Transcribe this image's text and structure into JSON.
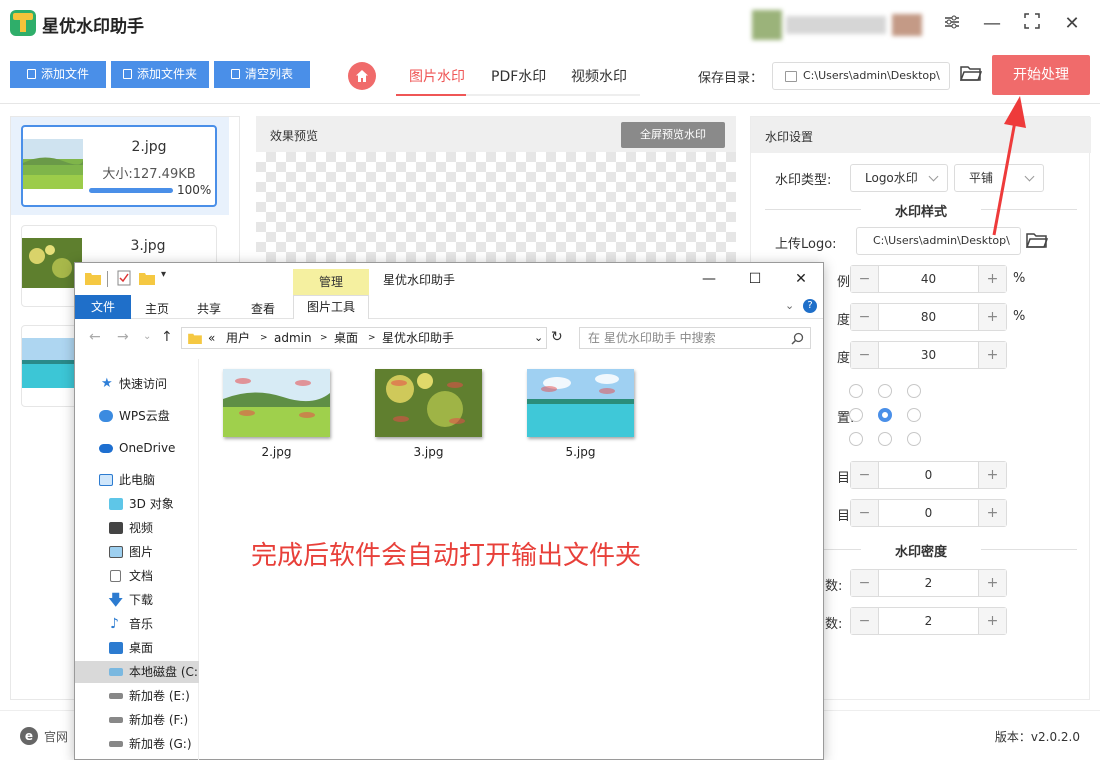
{
  "app": {
    "title": "星优水印助手",
    "window_controls": [
      "settings-icon",
      "minimize-icon",
      "maximize-icon",
      "close-icon"
    ]
  },
  "toolbar": {
    "add_file": "添加文件",
    "add_folder": "添加文件夹",
    "clear_list": "清空列表",
    "tabs": [
      {
        "label": "图片水印",
        "active": true
      },
      {
        "label": "PDF水印",
        "active": false
      },
      {
        "label": "视频水印",
        "active": false
      }
    ],
    "save_dir_label": "保存目录：",
    "save_dir_value": "C:\\Users\\admin\\Desktop\\",
    "start": "开始处理"
  },
  "file_list": [
    {
      "name": "2.jpg",
      "size": "大小:127.49KB",
      "progress": "100%",
      "progress_value": 100,
      "selected": true
    },
    {
      "name": "3.jpg",
      "selected": false
    },
    {
      "name": "5.jpg",
      "selected": false
    }
  ],
  "preview": {
    "title": "效果预览",
    "fullscreen": "全屏预览水印"
  },
  "settings": {
    "title": "水印设置",
    "type_label": "水印类型:",
    "type_value": "Logo水印",
    "mode_value": "平铺",
    "style_section": "水印样式",
    "upload_label": "上传Logo:",
    "upload_value": "C:\\Users\\admin\\Desktop\\",
    "steppers": [
      {
        "label": "例",
        "value": "40",
        "unit": "%"
      },
      {
        "label": "度",
        "value": "80",
        "unit": "%"
      },
      {
        "label": "度",
        "value": "30",
        "unit": ""
      },
      {
        "label": "目",
        "value": "0",
        "unit": ""
      },
      {
        "label": "目",
        "value": "0",
        "unit": ""
      }
    ],
    "position_label": "置:",
    "position_selected": 4,
    "density_section": "水印密度",
    "density": [
      {
        "label": "数:",
        "value": "2"
      },
      {
        "label": "数:",
        "value": "2"
      }
    ]
  },
  "footer": {
    "site": "官网",
    "version": "版本：v2.0.2.0"
  },
  "explorer": {
    "manage": "管理",
    "title": "星优水印助手",
    "ribbon_tabs": [
      "文件",
      "主页",
      "共享",
      "查看"
    ],
    "tools_tab": "图片工具",
    "address": [
      "«",
      "用户",
      "admin",
      "桌面",
      "星优水印助手"
    ],
    "search_placeholder": "在 星优水印助手 中搜索",
    "nav": [
      {
        "label": "快速访问",
        "icon": "star-icon"
      },
      {
        "label": "WPS云盘",
        "icon": "cloud-icon"
      },
      {
        "label": "OneDrive",
        "icon": "onedrive-icon"
      },
      {
        "label": "此电脑",
        "icon": "pc-icon"
      },
      {
        "label": "3D 对象",
        "icon": "cube-icon"
      },
      {
        "label": "视频",
        "icon": "video-icon"
      },
      {
        "label": "图片",
        "icon": "picture-icon"
      },
      {
        "label": "文档",
        "icon": "document-icon"
      },
      {
        "label": "下载",
        "icon": "download-icon"
      },
      {
        "label": "音乐",
        "icon": "music-icon"
      },
      {
        "label": "桌面",
        "icon": "desktop-icon"
      },
      {
        "label": "本地磁盘 (C:",
        "icon": "disk-icon",
        "selected": true
      },
      {
        "label": "新加卷 (E:)",
        "icon": "drive-icon"
      },
      {
        "label": "新加卷 (F:)",
        "icon": "drive-icon"
      },
      {
        "label": "新加卷 (G:)",
        "icon": "drive-icon"
      }
    ],
    "files": [
      "2.jpg",
      "3.jpg",
      "5.jpg"
    ],
    "note": "完成后软件会自动打开输出文件夹"
  },
  "colors": {
    "primary": "#4a8fe8",
    "accent": "#f06b6b",
    "note": "#e8403a"
  }
}
